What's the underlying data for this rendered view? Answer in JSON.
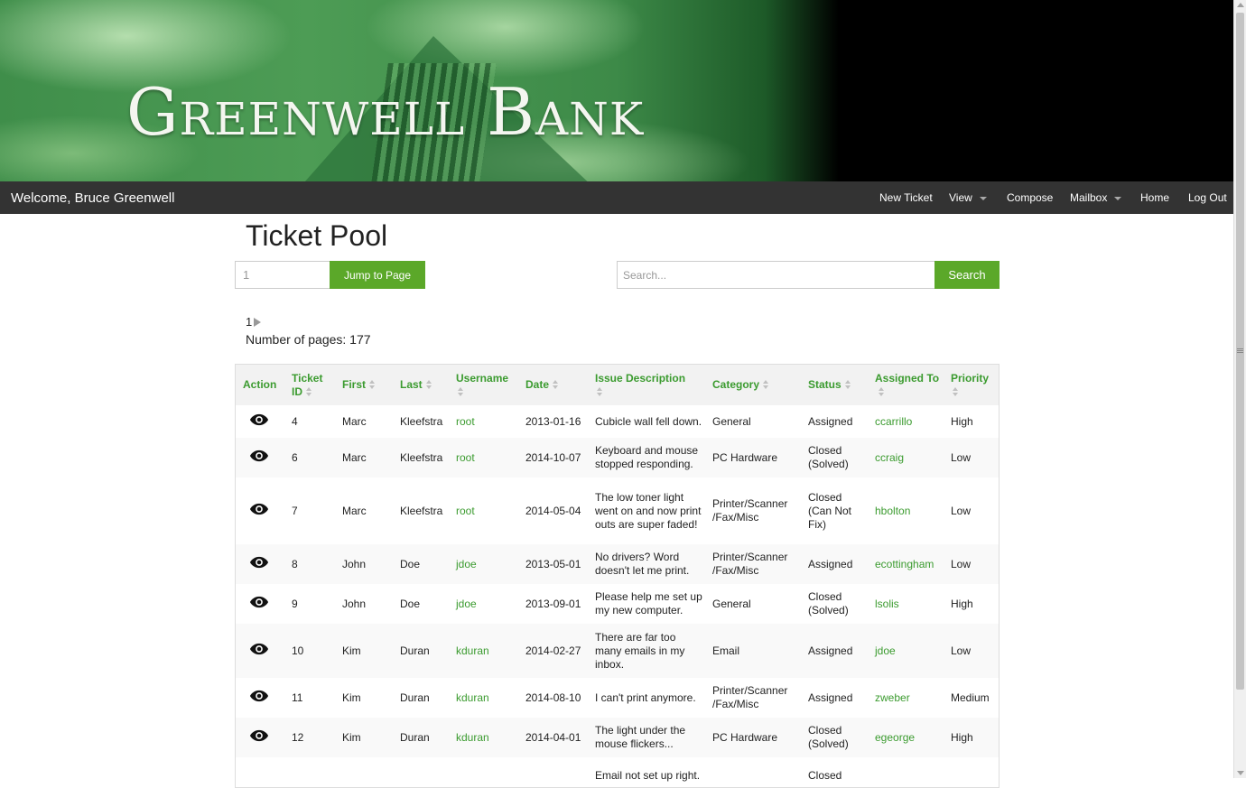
{
  "banner": {
    "brand": "Greenwell Bank"
  },
  "navbar": {
    "welcome": "Welcome, Bruce Greenwell",
    "items": [
      "New Ticket",
      "View",
      "Compose",
      "Mailbox",
      "Home",
      "Log Out"
    ]
  },
  "page": {
    "title": "Ticket Pool",
    "page_input_value": "1",
    "jump_label": "Jump to Page",
    "search_placeholder": "Search...",
    "search_label": "Search",
    "current_page": "1",
    "num_pages_text": "Number of pages: 177"
  },
  "table": {
    "headers": [
      "Action",
      "Ticket ID",
      "First",
      "Last",
      "Username",
      "Date",
      "Issue Description",
      "Category",
      "Status",
      "Assigned To",
      "Priority"
    ],
    "rows": [
      {
        "id": "4",
        "first": "Marc",
        "last": "Kleefstra",
        "username": "root",
        "date": "2013-01-16",
        "issue": "Cubicle wall fell down.",
        "category": "General",
        "status": "Assigned",
        "assigned": "ccarrillo",
        "priority": "High"
      },
      {
        "id": "6",
        "first": "Marc",
        "last": "Kleefstra",
        "username": "root",
        "date": "2014-10-07",
        "issue": "Keyboard and mouse stopped responding.",
        "category": "PC Hardware",
        "status": "Closed (Solved)",
        "assigned": "ccraig",
        "priority": "Low"
      },
      {
        "id": "7",
        "first": "Marc",
        "last": "Kleefstra",
        "username": "root",
        "date": "2014-05-04",
        "issue": "The low toner light went on and now print outs are super faded!",
        "category": "Printer/Scanner /Fax/Misc",
        "status": "Closed (Can Not Fix)",
        "assigned": "hbolton",
        "priority": "Low"
      },
      {
        "id": "8",
        "first": "John",
        "last": "Doe",
        "username": "jdoe",
        "date": "2013-05-01",
        "issue": "No drivers? Word doesn't let me print.",
        "category": "Printer/Scanner /Fax/Misc",
        "status": "Assigned",
        "assigned": "ecottingham",
        "priority": "Low"
      },
      {
        "id": "9",
        "first": "John",
        "last": "Doe",
        "username": "jdoe",
        "date": "2013-09-01",
        "issue": "Please help me set up my new computer.",
        "category": "General",
        "status": "Closed (Solved)",
        "assigned": "lsolis",
        "priority": "High"
      },
      {
        "id": "10",
        "first": "Kim",
        "last": "Duran",
        "username": "kduran",
        "date": "2014-02-27",
        "issue": "There are far too many emails in my inbox.",
        "category": "Email",
        "status": "Assigned",
        "assigned": "jdoe",
        "priority": "Low"
      },
      {
        "id": "11",
        "first": "Kim",
        "last": "Duran",
        "username": "kduran",
        "date": "2014-08-10",
        "issue": "I can't print anymore.",
        "category": "Printer/Scanner /Fax/Misc",
        "status": "Assigned",
        "assigned": "zweber",
        "priority": "Medium"
      },
      {
        "id": "12",
        "first": "Kim",
        "last": "Duran",
        "username": "kduran",
        "date": "2014-04-01",
        "issue": "The light under the mouse flickers...",
        "category": "PC Hardware",
        "status": "Closed (Solved)",
        "assigned": "egeorge",
        "priority": "High"
      },
      {
        "id": "",
        "first": "",
        "last": "",
        "username": "",
        "date": "",
        "issue": "Email not set up right.",
        "category": "",
        "status": "Closed",
        "assigned": "",
        "priority": ""
      }
    ]
  },
  "colors": {
    "accent": "#5ba829",
    "link": "#3b9b2f",
    "navbar": "#333333"
  }
}
